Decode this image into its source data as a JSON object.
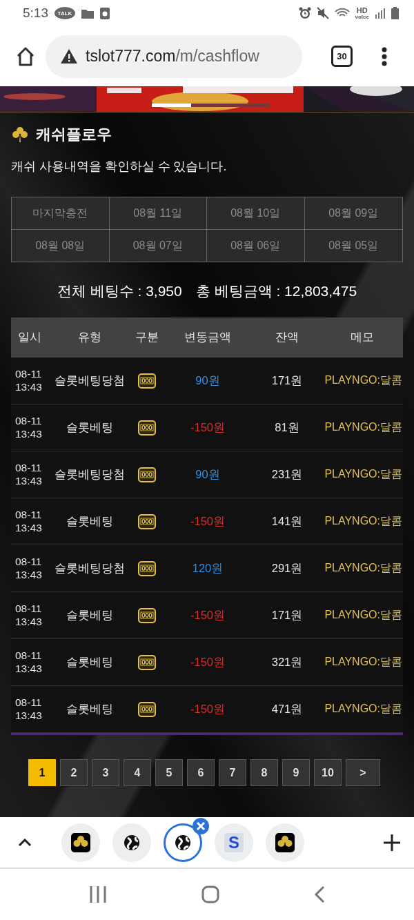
{
  "status_bar": {
    "time": "5:13",
    "talk_badge": "TALK",
    "network_label": "HD",
    "network_sublabel": "voice"
  },
  "browser": {
    "url_host": "tslot777.com",
    "url_path": "/m/cashflow",
    "tab_count": "30"
  },
  "page": {
    "title": "캐쉬플로우",
    "subtitle": "캐쉬 사용내역을 확인하실 수 있습니다.",
    "date_tabs": [
      {
        "label": "마지막충전",
        "selected": false
      },
      {
        "label": "08월 11일",
        "selected": false
      },
      {
        "label": "08월 10일",
        "selected": false
      },
      {
        "label": "08월 09일",
        "selected": false
      },
      {
        "label": "08월 08일",
        "selected": false
      },
      {
        "label": "08월 07일",
        "selected": false
      },
      {
        "label": "08월 06일",
        "selected": false
      },
      {
        "label": "08월 05일",
        "selected": false
      }
    ],
    "summary": [
      {
        "label": "전체 베팅수 : 3,950"
      },
      {
        "label": "총 베팅금액 : 12,803,475"
      }
    ],
    "table": {
      "columns": [
        "일시",
        "유형",
        "구분",
        "변동금액",
        "잔액",
        "메모"
      ],
      "rows": [
        {
          "date": "08-11",
          "time": "13:43",
          "type": "슬롯베팅당첨",
          "amount": "90원",
          "color": "#2f8fe0",
          "balance": "171원",
          "memo": "PLAYNGO:달콤"
        },
        {
          "date": "08-11",
          "time": "13:43",
          "type": "슬롯베팅",
          "amount": "-150원",
          "color": "#d7302f",
          "balance": "81원",
          "memo": "PLAYNGO:달콤"
        },
        {
          "date": "08-11",
          "time": "13:43",
          "type": "슬롯베팅당첨",
          "amount": "90원",
          "color": "#2f8fe0",
          "balance": "231원",
          "memo": "PLAYNGO:달콤"
        },
        {
          "date": "08-11",
          "time": "13:43",
          "type": "슬롯베팅",
          "amount": "-150원",
          "color": "#d7302f",
          "balance": "141원",
          "memo": "PLAYNGO:달콤"
        },
        {
          "date": "08-11",
          "time": "13:43",
          "type": "슬롯베팅당첨",
          "amount": "120원",
          "color": "#2f8fe0",
          "balance": "291원",
          "memo": "PLAYNGO:달콤"
        },
        {
          "date": "08-11",
          "time": "13:43",
          "type": "슬롯베팅",
          "amount": "-150원",
          "color": "#d7302f",
          "balance": "171원",
          "memo": "PLAYNGO:달콤"
        },
        {
          "date": "08-11",
          "time": "13:43",
          "type": "슬롯베팅",
          "amount": "-150원",
          "color": "#d7302f",
          "balance": "321원",
          "memo": "PLAYNGO:달콤"
        },
        {
          "date": "08-11",
          "time": "13:43",
          "type": "슬롯베팅",
          "amount": "-150원",
          "color": "#d7302f",
          "balance": "471원",
          "memo": "PLAYNGO:달콤"
        }
      ]
    },
    "pagination": [
      {
        "label": "1",
        "selected": true
      },
      {
        "label": "2",
        "selected": false
      },
      {
        "label": "3",
        "selected": false
      },
      {
        "label": "4",
        "selected": false
      },
      {
        "label": "5",
        "selected": false
      },
      {
        "label": "6",
        "selected": false
      },
      {
        "label": "7",
        "selected": false
      },
      {
        "label": "8",
        "selected": false
      },
      {
        "label": "9",
        "selected": false
      },
      {
        "label": "10",
        "selected": false
      },
      {
        "label": ">",
        "selected": false
      }
    ]
  },
  "tab_strip": [
    {
      "kind": "clover",
      "selected": false
    },
    {
      "kind": "globe",
      "selected": false
    },
    {
      "kind": "globe",
      "selected": true
    },
    {
      "kind": "letter",
      "letter": "S",
      "selected": false
    },
    {
      "kind": "clover",
      "selected": false
    }
  ]
}
